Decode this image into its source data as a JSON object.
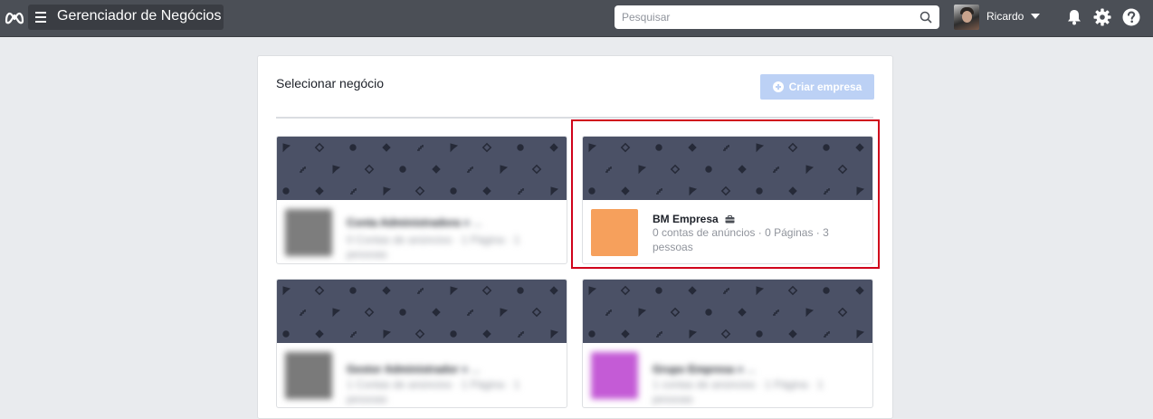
{
  "topbar": {
    "app_title": "Gerenciador de Negócios",
    "search_placeholder": "Pesquisar",
    "user_name": "Ricardo"
  },
  "panel": {
    "title": "Selecionar negócio",
    "create_button": "Criar empresa"
  },
  "businesses": [
    {
      "name": "Conta Administradora",
      "meta": "0 Contas de anúncios · 1 Página · 1 pessoas",
      "thumb_color": "#7d7d7d",
      "obscured": true
    },
    {
      "name": "BM Empresa",
      "meta": "0 contas de anúncios · 0 Páginas · 3 pessoas",
      "thumb_color": "#f6a05c",
      "obscured": false,
      "selected": true
    },
    {
      "name": "Gestor Administrador",
      "meta": "1 Contas de anúncios · 1 Página · 1 pessoas",
      "thumb_color": "#7a7a7a",
      "obscured": true
    },
    {
      "name": "Grupo Empresa",
      "meta": "1 contas de anúncios · 1 Página · 1 pessoas",
      "thumb_color": "#c45bd6",
      "obscured": true
    }
  ]
}
